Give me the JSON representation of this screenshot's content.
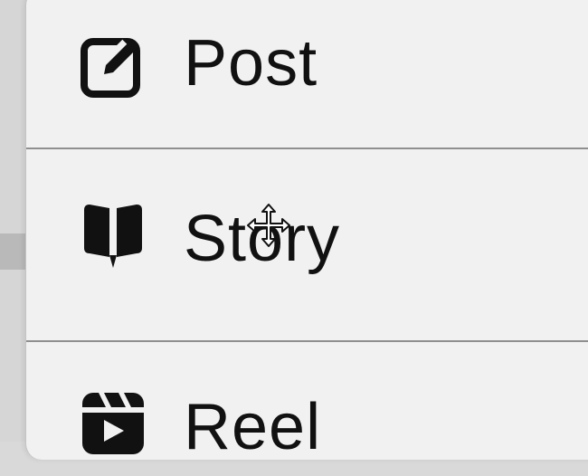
{
  "menu": {
    "items": [
      {
        "label": "Post",
        "icon": "edit-square-icon"
      },
      {
        "label": "Story",
        "icon": "book-icon"
      },
      {
        "label": "Reel",
        "icon": "clapperboard-icon"
      }
    ]
  },
  "cursor": {
    "type": "move-cursor-icon"
  }
}
